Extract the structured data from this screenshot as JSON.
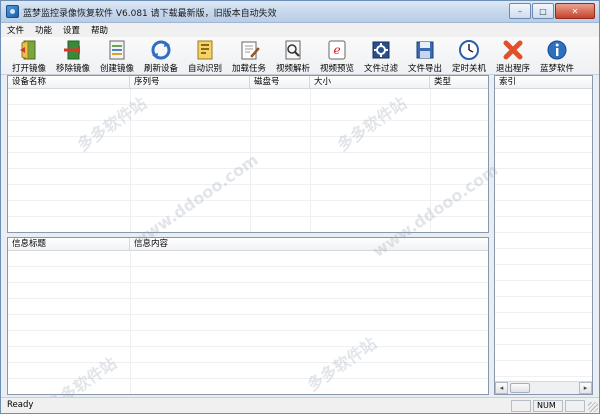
{
  "window": {
    "title": "蓝梦监控录像恢复软件 V6.081 请下载最新版，旧版本自动失效",
    "controls": {
      "minimize": "–",
      "maximize": "□",
      "close": "✕"
    }
  },
  "menu": {
    "items": [
      "文件",
      "功能",
      "设置",
      "帮助"
    ]
  },
  "toolbar": {
    "buttons": [
      {
        "label": "打开镜像",
        "icon": "open-image-icon"
      },
      {
        "label": "移除镜像",
        "icon": "remove-image-icon"
      },
      {
        "label": "创建镜像",
        "icon": "create-image-icon"
      },
      {
        "label": "刷新设备",
        "icon": "refresh-device-icon"
      },
      {
        "label": "自动识别",
        "icon": "auto-detect-icon"
      },
      {
        "label": "加载任务",
        "icon": "load-task-icon"
      },
      {
        "label": "视频解析",
        "icon": "video-parse-icon"
      },
      {
        "label": "视频预览",
        "icon": "video-preview-icon"
      },
      {
        "label": "文件过滤",
        "icon": "file-filter-icon"
      },
      {
        "label": "文件导出",
        "icon": "file-export-icon"
      },
      {
        "label": "定时关机",
        "icon": "timed-shutdown-icon"
      },
      {
        "label": "退出程序",
        "icon": "exit-icon"
      },
      {
        "label": "蓝梦软件",
        "icon": "about-icon"
      }
    ]
  },
  "device_table": {
    "columns": [
      "设备名称",
      "序列号",
      "磁盘号",
      "大小",
      "类型"
    ]
  },
  "info_table": {
    "columns": [
      "信息标题",
      "信息内容"
    ]
  },
  "index_panel": {
    "header": "索引"
  },
  "scrollbar": {
    "left_arrow": "◂",
    "right_arrow": "▸"
  },
  "status": {
    "text": "Ready",
    "num_indicator": "NUM"
  },
  "watermark": {
    "text": "多多软件站",
    "url": "www.ddooo.com"
  },
  "colors": {
    "title_bar": "#c6d7ec",
    "close_button": "#c7412a",
    "accent_blue": "#1c5fa8"
  }
}
